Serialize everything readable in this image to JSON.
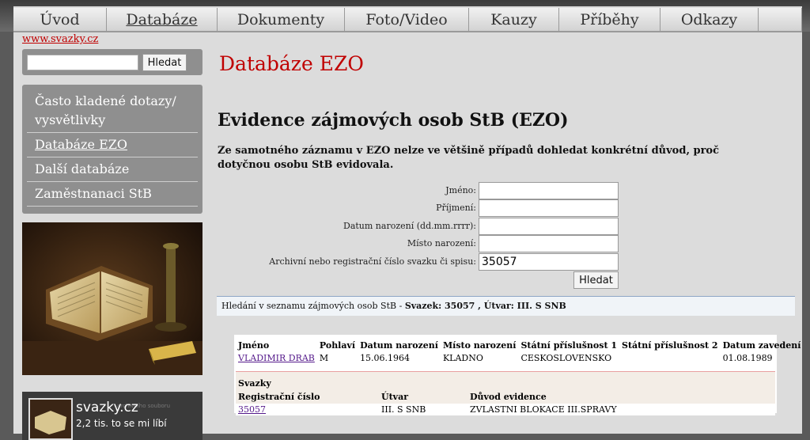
{
  "nav": {
    "items": [
      {
        "label": "Úvod"
      },
      {
        "label": "Databáze"
      },
      {
        "label": "Dokumenty"
      },
      {
        "label": "Foto/Video"
      },
      {
        "label": "Kauzy"
      },
      {
        "label": "Příběhy"
      },
      {
        "label": "Odkazy"
      },
      {
        "label": ""
      }
    ],
    "active_index": 1
  },
  "site_link": "www.svazky.cz",
  "search": {
    "value": "",
    "button": "Hledat"
  },
  "sidebar": {
    "items": [
      {
        "label": "Často kladené dotazy/ vysvětlivky"
      },
      {
        "label": "Databáze EZO"
      },
      {
        "label": "Další databáze"
      },
      {
        "label": "Zaměstnanaci StB"
      }
    ]
  },
  "fb_widget": {
    "name": "svazky.cz",
    "likes": "2,2 tis. to se mi líbí",
    "bg_text": "archivního souboru"
  },
  "main": {
    "page_title": "Databáze EZO",
    "heading": "Evidence zájmových osob StB (EZO)",
    "notice": "Ze samotného záznamu v EZO nelze ve většině případů dohledat konkrétní důvod, proč dotyčnou osobu StB evidovala."
  },
  "form": {
    "fields": [
      {
        "label": "Jméno:",
        "value": ""
      },
      {
        "label": "Příjmení:",
        "value": ""
      },
      {
        "label": "Datum narození (dd.mm.rrrr):",
        "value": ""
      },
      {
        "label": "Místo narození:",
        "value": ""
      },
      {
        "label": "Archivní nebo registrační číslo svazku či spisu:",
        "value": "35057"
      }
    ],
    "submit": "Hledat"
  },
  "result_bar": {
    "prefix": "Hledání v seznamu zájmových osob StB - ",
    "query": "Svazek: 35057 , Útvar: III. S SNB"
  },
  "results": {
    "columns": [
      "Jméno",
      "Pohlaví",
      "Datum narození",
      "Místo narození",
      "Státní příslušnost 1",
      "Státní příslušnost 2",
      "Datum zavedení"
    ],
    "rows": [
      [
        "VLADIMIR DRAB",
        "M",
        "15.06.1964",
        "KLADNO",
        "CESKOSLOVENSKO",
        "",
        "01.08.1989"
      ]
    ],
    "svazky_title": "Svazky",
    "svazky_columns": [
      "Registrační číslo",
      "Útvar",
      "Důvod evidence"
    ],
    "svazky_rows": [
      [
        "35057",
        "III. S SNB",
        "ZVLASTNI BLOKACE III.SPRAVY"
      ]
    ]
  }
}
